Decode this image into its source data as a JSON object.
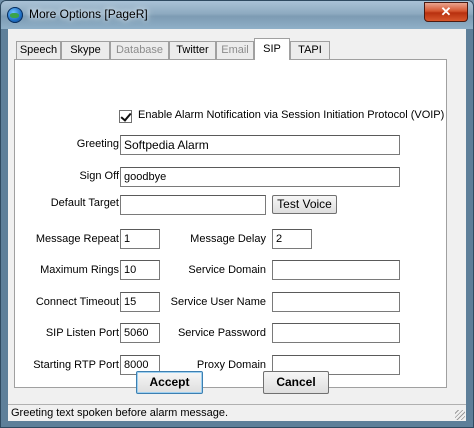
{
  "window": {
    "title": "More Options [PageR]",
    "close_glyph": "✕"
  },
  "tabs": [
    {
      "label": "Speech",
      "state": "normal"
    },
    {
      "label": "Skype",
      "state": "normal"
    },
    {
      "label": "Database",
      "state": "disabled"
    },
    {
      "label": "Twitter",
      "state": "normal"
    },
    {
      "label": "Email",
      "state": "disabled"
    },
    {
      "label": "SIP",
      "state": "active"
    },
    {
      "label": "TAPI",
      "state": "normal"
    }
  ],
  "sip": {
    "enable_alarm_label": "Enable Alarm Notification via Session Initiation Protocol (VOIP)",
    "enable_alarm_checked": true,
    "greeting_label": "Greeting",
    "greeting_value": "Softpedia Alarm",
    "signoff_label": "Sign Off",
    "signoff_value": "goodbye",
    "default_target_label": "Default Target",
    "default_target_value": "",
    "test_voice_label": "Test Voice",
    "message_repeat_label": "Message Repeat",
    "message_repeat_value": "1",
    "message_delay_label": "Message Delay",
    "message_delay_value": "2",
    "maximum_rings_label": "Maximum Rings",
    "maximum_rings_value": "10",
    "service_domain_label": "Service Domain",
    "service_domain_value": "",
    "connect_timeout_label": "Connect Timeout",
    "connect_timeout_value": "15",
    "service_user_label": "Service User Name",
    "service_user_value": "",
    "listen_port_label": "SIP Listen Port",
    "listen_port_value": "5060",
    "service_password_label": "Service Password",
    "service_password_value": "",
    "rtp_port_label": "Starting RTP Port",
    "rtp_port_value": "8000",
    "proxy_domain_label": "Proxy Domain",
    "proxy_domain_value": ""
  },
  "buttons": {
    "accept": "Accept",
    "cancel": "Cancel"
  },
  "status": {
    "text": "Greeting text spoken before alarm message."
  }
}
